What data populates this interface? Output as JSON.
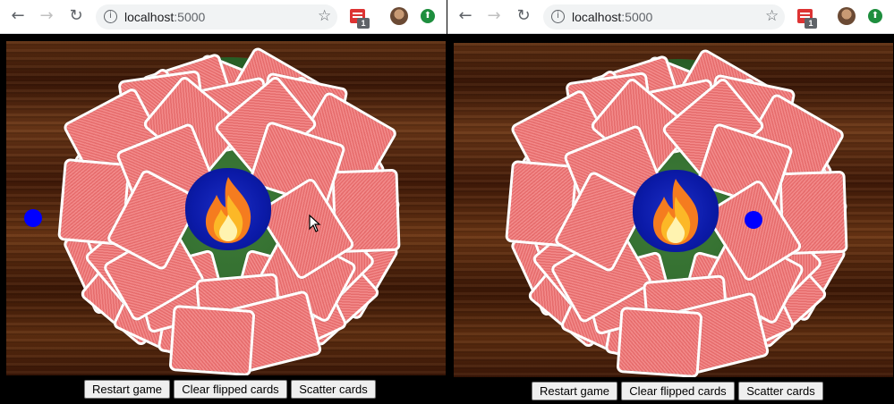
{
  "browser": {
    "url_host": "localhost",
    "url_port": ":5000",
    "extension_badge": "1"
  },
  "controls": {
    "restart_label": "Restart game",
    "clear_label": "Clear flipped cards",
    "scatter_label": "Scatter cards"
  },
  "icons": {
    "back": "back-arrow-icon",
    "forward": "forward-arrow-icon",
    "reload": "reload-icon",
    "site_info": "info-icon",
    "bookmark": "star-icon",
    "extension": "extension-icon",
    "profile": "avatar",
    "update": "update-icon",
    "fire": "fire-icon",
    "cursor": "mouse-cursor-icon"
  },
  "colors": {
    "card_back": "#f28a8a",
    "card_border": "#ffffff",
    "felt": "#2f6a2c",
    "fire_pit": "#0b1aa8",
    "player_dot": "#0000ff",
    "table_wood": "#4a1f0a"
  }
}
